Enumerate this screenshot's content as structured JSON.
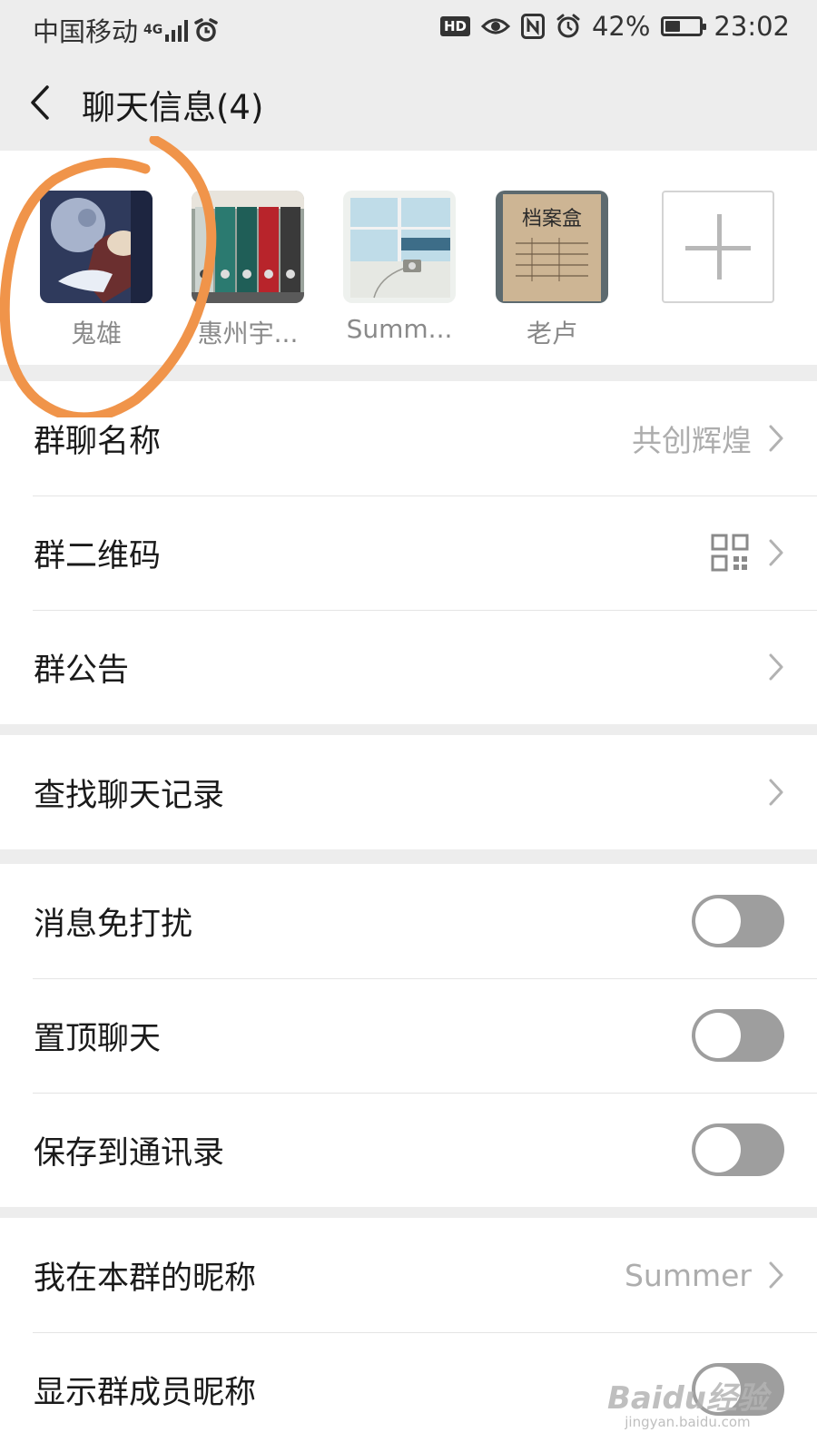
{
  "status": {
    "carrier": "中国移动",
    "network": "4G",
    "hd": "HD",
    "battery_pct": "42%",
    "battery_level": 0.42,
    "time": "23:02"
  },
  "header": {
    "title": "聊天信息(4)"
  },
  "members": [
    {
      "name": "鬼雄",
      "avatar": "anime-character-avatar"
    },
    {
      "name": "惠州宇...",
      "avatar": "binder-folders-avatar"
    },
    {
      "name": "Summ...",
      "avatar": "window-scene-avatar"
    },
    {
      "name": "老卢",
      "avatar": "archive-box-avatar",
      "avatar_text": "档案盒"
    }
  ],
  "settings": {
    "group_name": {
      "label": "群聊名称",
      "value": "共创辉煌"
    },
    "group_qr": {
      "label": "群二维码"
    },
    "announcement": {
      "label": "群公告"
    },
    "search_history": {
      "label": "查找聊天记录"
    },
    "mute": {
      "label": "消息免打扰",
      "on": false
    },
    "pin": {
      "label": "置顶聊天",
      "on": false
    },
    "save_contacts": {
      "label": "保存到通讯录",
      "on": false
    },
    "my_nickname": {
      "label": "我在本群的昵称",
      "value": "Summer"
    },
    "show_nicknames": {
      "label": "显示群成员昵称",
      "on": false
    }
  },
  "watermark": {
    "brand": "Baidu经验",
    "url": "jingyan.baidu.com"
  },
  "colors": {
    "background": "#ededed",
    "toggle_off": "#9e9e9e",
    "annotation_circle": "#f0944a"
  }
}
